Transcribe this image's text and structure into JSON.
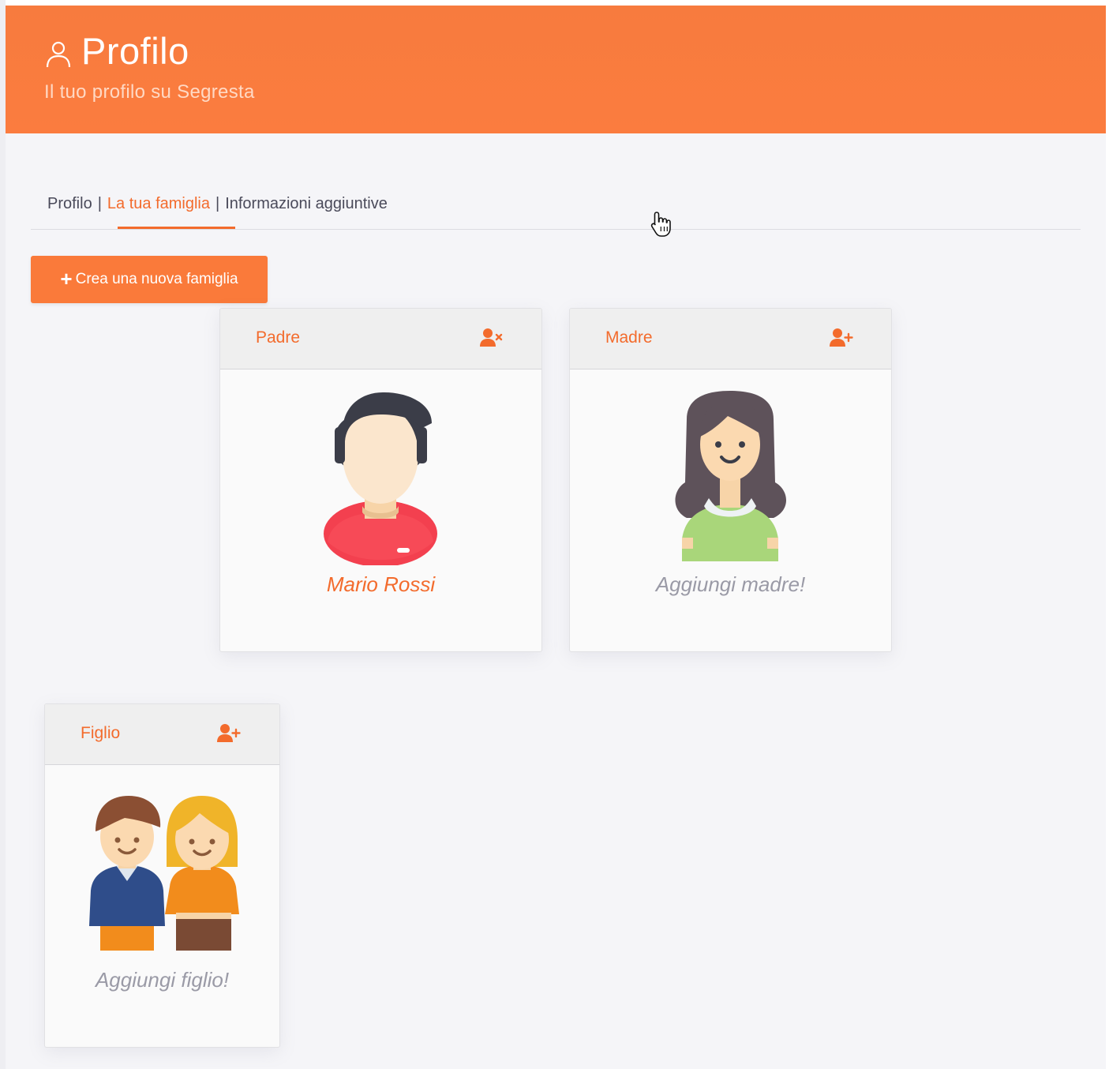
{
  "header": {
    "title": "Profilo",
    "subtitle": "Il tuo profilo su Segresta",
    "icon": "user-outline-icon",
    "color": "#fb7c3f"
  },
  "tabs": [
    {
      "label": "Profilo",
      "active": false
    },
    {
      "label": "La tua famiglia",
      "active": true
    },
    {
      "label": "Informazioni aggiuntive",
      "active": false
    }
  ],
  "tab_separator": "|",
  "create_button": {
    "icon": "plus-icon",
    "label": "Crea una nuova famiglia"
  },
  "members": {
    "father": {
      "role": "Padre",
      "action_icon": "remove-user-icon",
      "name": "Mario Rossi",
      "avatar": "man-avatar"
    },
    "mother": {
      "role": "Madre",
      "action_icon": "add-user-icon",
      "name": "Aggiungi madre!",
      "avatar": "woman-avatar"
    },
    "child": {
      "role": "Figlio",
      "action_icon": "add-user-icon",
      "name": "Aggiungi figlio!",
      "avatar": "children-avatar"
    }
  },
  "colors": {
    "accent": "#f36b2c",
    "button": "#fa7a3a",
    "background": "#f5f5f8",
    "muted_text": "#9a9aa6"
  }
}
